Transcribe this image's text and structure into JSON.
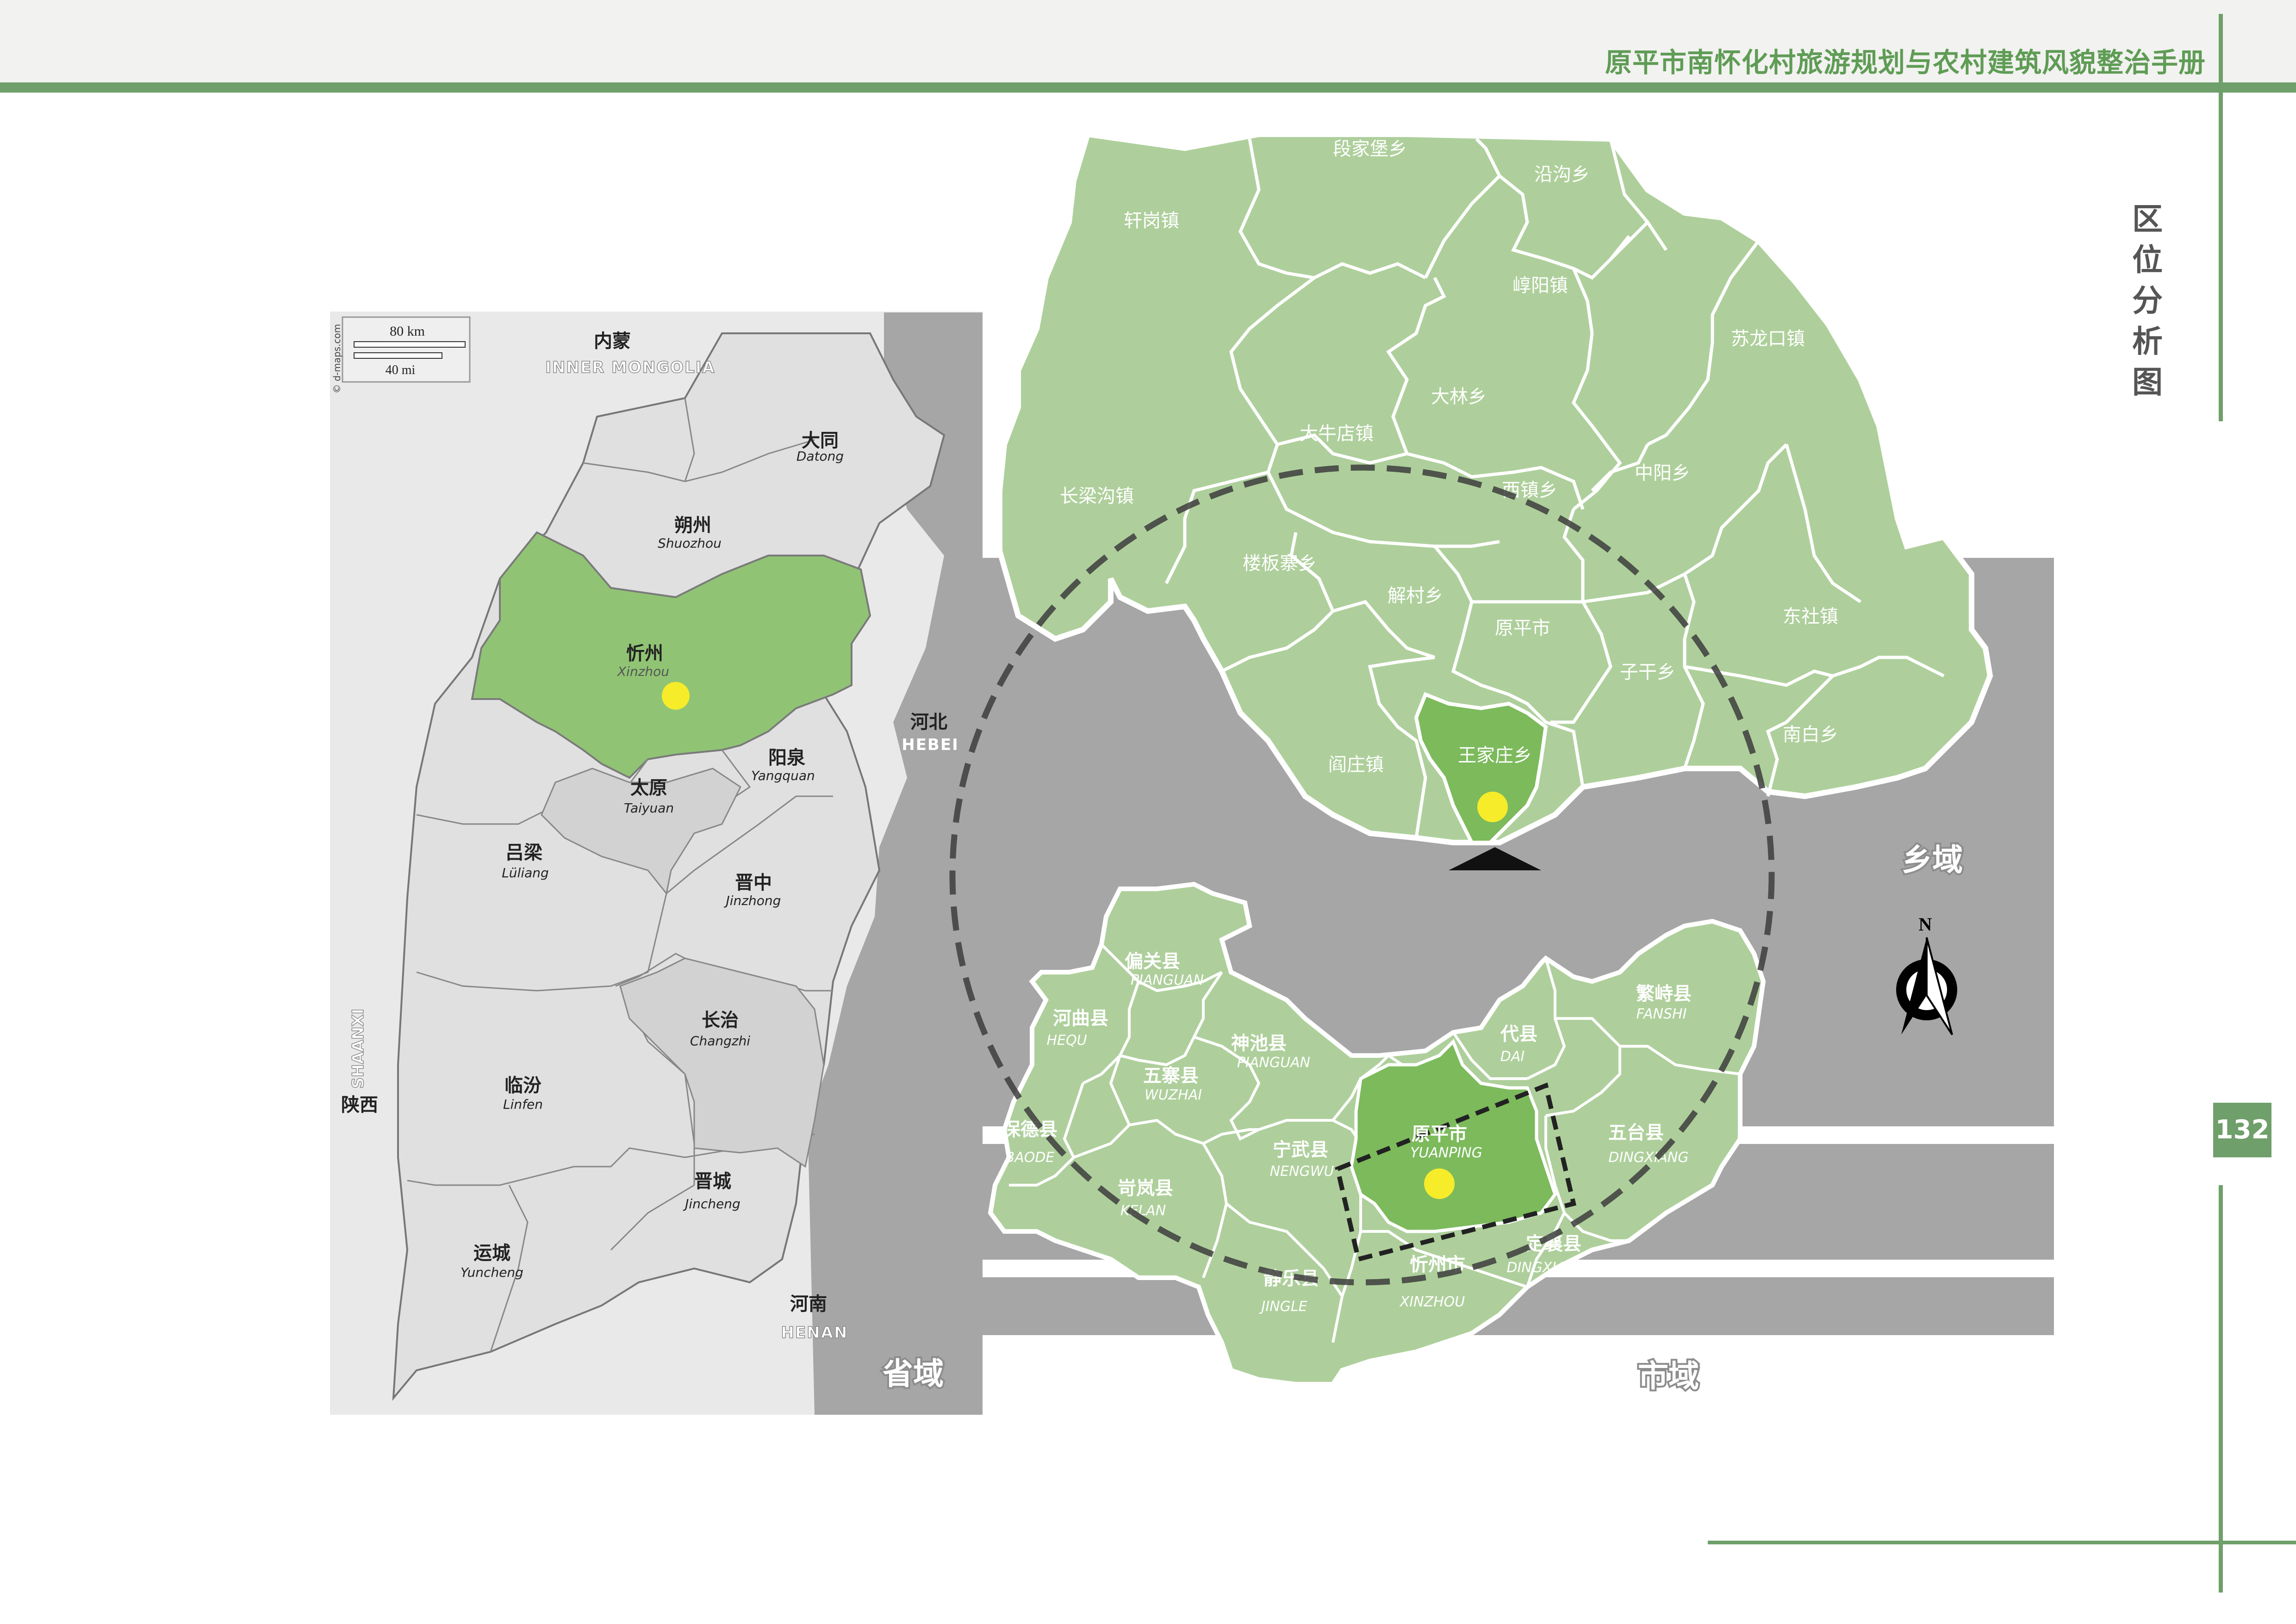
{
  "header": {
    "title": "原平市南怀化村旅游规划与农村建筑风貌整治手册"
  },
  "side_title": [
    "区",
    "位",
    "分",
    "析",
    "图"
  ],
  "page_number": "132",
  "scale_bar": {
    "km": "80 km",
    "mi": "40 mi",
    "credit": "© d-maps.com"
  },
  "province_panel": {
    "caption": "省域",
    "regions": [
      {
        "cn": "内蒙",
        "en": "INNER MONGOLIA"
      },
      {
        "cn": "大同",
        "en": "Datong"
      },
      {
        "cn": "朔州",
        "en": "Shuozhou"
      },
      {
        "cn": "忻州",
        "en": "Xinzhou"
      },
      {
        "cn": "阳泉",
        "en": "Yangquan"
      },
      {
        "cn": "太原",
        "en": "Taiyuan"
      },
      {
        "cn": "吕梁",
        "en": "Lüliang"
      },
      {
        "cn": "晋中",
        "en": "Jinzhong"
      },
      {
        "cn": "长治",
        "en": "Changzhi"
      },
      {
        "cn": "临汾",
        "en": "Linfen"
      },
      {
        "cn": "晋城",
        "en": "Jincheng"
      },
      {
        "cn": "运城",
        "en": "Yuncheng"
      },
      {
        "cn": "河北",
        "en": "HEBEI"
      },
      {
        "cn": "河南",
        "en": "HENAN"
      },
      {
        "cn": "陕西",
        "en": "SHAANXI"
      }
    ]
  },
  "city_panel": {
    "caption": "市域",
    "regions": [
      {
        "cn": "偏关县",
        "en": "PIANGUAN"
      },
      {
        "cn": "河曲县",
        "en": "HEQU"
      },
      {
        "cn": "神池县",
        "en": "PIANGUAN"
      },
      {
        "cn": "五寨县",
        "en": "WUZHAI"
      },
      {
        "cn": "保德县",
        "en": "BAODE"
      },
      {
        "cn": "岢岚县",
        "en": "KELAN"
      },
      {
        "cn": "宁武县",
        "en": "NENGWU"
      },
      {
        "cn": "原平市",
        "en": "YUANPING"
      },
      {
        "cn": "代县",
        "en": "DAI"
      },
      {
        "cn": "繁峙县",
        "en": "FANSHI"
      },
      {
        "cn": "五台县",
        "en": "DINGXIANG"
      },
      {
        "cn": "定襄县",
        "en": "DINGXIANG"
      },
      {
        "cn": "忻州市",
        "en": "XINZHOU"
      },
      {
        "cn": "静乐县",
        "en": "JINGLE"
      }
    ]
  },
  "township_panel": {
    "caption": "乡域",
    "regions": [
      "段家堡乡",
      "沿沟乡",
      "轩岗镇",
      "崞阳镇",
      "苏龙口镇",
      "大林乡",
      "大牛店镇",
      "长梁沟镇",
      "西镇乡",
      "中阳乡",
      "楼板寨乡",
      "解村乡",
      "原平市",
      "东社镇",
      "子干乡",
      "王家庄乡",
      "阎庄镇",
      "南白乡"
    ]
  },
  "compass": {
    "label": "N"
  },
  "colors": {
    "accent": "#6f9f6a",
    "highlight": "#8fc46f",
    "marker": "#f6ec2a",
    "township": "#aecf9b"
  }
}
